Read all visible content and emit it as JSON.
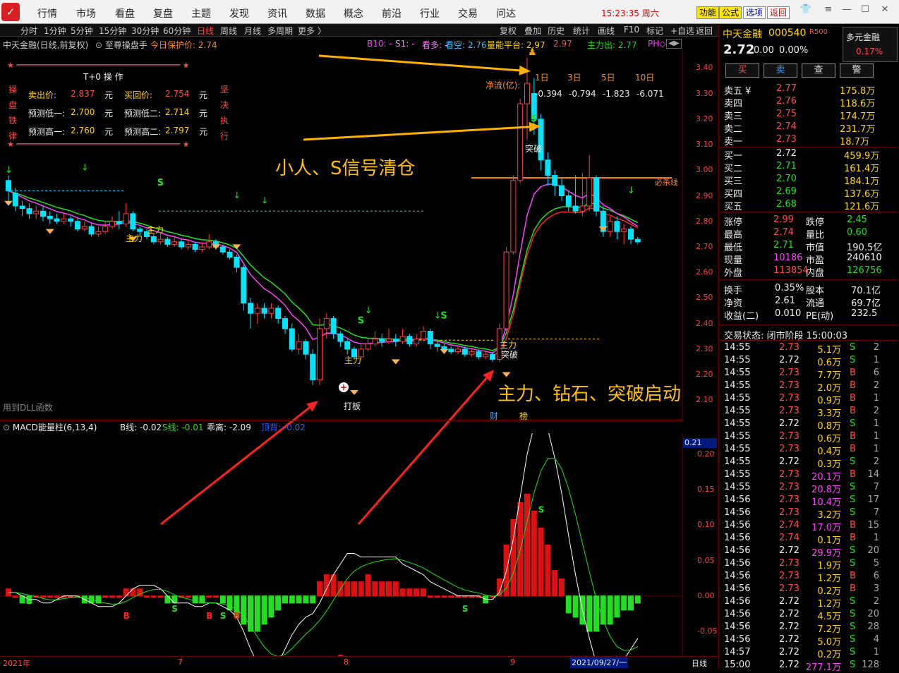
{
  "app": {
    "logo": "✓",
    "menu": [
      "行情",
      "市场",
      "看盘",
      "复盘",
      "主题",
      "发现",
      "资讯",
      "数据",
      "概念",
      "前沿",
      "行业",
      "交易",
      "问达"
    ],
    "clock": "15:23:35 周六",
    "buttons": [
      "功能",
      "公式",
      "选项",
      "返回"
    ]
  },
  "toolbar": {
    "periods": [
      "分时",
      "1分钟",
      "5分钟",
      "15分钟",
      "30分钟",
      "60分钟",
      "日线",
      "周线",
      "月线",
      "多周期",
      "更多 〉"
    ],
    "right_tools": [
      "复权",
      "叠加",
      "历史",
      "统计",
      "画线",
      "F10",
      "标记",
      "+自选",
      "返回"
    ]
  },
  "chart_header": {
    "title": "中天金融(日线,前复权)",
    "formula": "至尊操盘手",
    "protect": "今日保护价: 2.74",
    "b10": "B10: -",
    "s1": "S1: -",
    "kanduo": "看多: -",
    "kankong": "看空: 2.76",
    "platform": "量能平台: 2.97",
    "platform2": "2.97",
    "zhuli": "主力出: 2.77",
    "ph": "PH◇"
  },
  "t0": {
    "title": "T+0 操 作",
    "side_left": [
      "操",
      "盘",
      "铁",
      "律"
    ],
    "side_right": [
      "坚",
      "决",
      "执",
      "行"
    ],
    "sell_label": "卖出价:",
    "sell": "2.837",
    "buyback_label": "买回价:",
    "buyback": "2.754",
    "low1_label": "预测低一:",
    "low1": "2.700",
    "low2_label": "预测低二:",
    "low2": "2.714",
    "high1_label": "预测高一:",
    "high1": "2.760",
    "high2_label": "预测高二:",
    "high2": "2.797",
    "unit": "元"
  },
  "netflow": {
    "label": "净流(亿):",
    "headers": [
      "1日",
      "3日",
      "5日",
      "10日"
    ],
    "values": [
      "-0.394",
      "-0.794",
      "-1.823",
      "-6.071"
    ]
  },
  "annotations": {
    "a1": "小人、S信号清仓",
    "a2": "主力、钻石、突破启动",
    "kill_line": "必杀线",
    "zhuli": "主力",
    "tupo": "突破",
    "daban": "打板",
    "dll": "用到DLL函数",
    "cai": "财",
    "bang": "榜"
  },
  "price_axis": [
    "3.40",
    "3.30",
    "3.20",
    "3.10",
    "3.00",
    "2.90",
    "2.80",
    "2.70",
    "2.60",
    "2.50",
    "2.40",
    "2.30",
    "2.20",
    "2.10"
  ],
  "macd": {
    "title": "MACD能量柱(6,13,4)",
    "b": "B线: -0.02",
    "s": "S线: -0.01",
    "div": "乖离: -2.09",
    "extra": "顶背: -0.02",
    "current": "0.21",
    "axis": [
      "0.20",
      "0.15",
      "0.10",
      "0.05",
      "0.00",
      "-0.05"
    ]
  },
  "xaxis": {
    "labels": [
      "2021年",
      "7",
      "8",
      "9"
    ],
    "date": "2021/09/27/一",
    "mode": "日线"
  },
  "stock": {
    "name": "中天金融",
    "code": "000540",
    "tag": "R500",
    "sector": "多元金融",
    "price": "2.72",
    "change": "0.00",
    "pct": "0.00%",
    "sector_pct": "0.17%",
    "actions": [
      "买",
      "卖",
      "查",
      "警"
    ]
  },
  "orderbook": {
    "asks": [
      [
        "卖五 ¥",
        "2.77",
        "175.8万"
      ],
      [
        "卖四",
        "2.76",
        "118.6万"
      ],
      [
        "卖三",
        "2.75",
        "174.7万"
      ],
      [
        "卖二",
        "2.74",
        "231.7万"
      ],
      [
        "卖一",
        "2.73",
        "18.7万"
      ]
    ],
    "bids": [
      [
        "买一",
        "2.72",
        "459.9万"
      ],
      [
        "买二",
        "2.71",
        "161.4万"
      ],
      [
        "买三",
        "2.70",
        "184.1万"
      ],
      [
        "买四",
        "2.69",
        "137.6万"
      ],
      [
        "买五",
        "2.68",
        "121.6万"
      ]
    ]
  },
  "stats": [
    [
      "涨停",
      "2.99",
      "跌停",
      "2.45"
    ],
    [
      "最高",
      "2.74",
      "量比",
      "0.60"
    ],
    [
      "最低",
      "2.71",
      "市值",
      "190.5亿"
    ],
    [
      "现量",
      "10186",
      "市盈",
      "240610"
    ],
    [
      "外盘",
      "113854",
      "内盘",
      "126756"
    ]
  ],
  "stats2": [
    [
      "换手",
      "0.35%",
      "股本",
      "70.1亿"
    ],
    [
      "净资",
      "2.61",
      "流通",
      "69.7亿"
    ],
    [
      "收益(二)",
      "0.010",
      "PE(动)",
      "232.5"
    ]
  ],
  "trade_status": "交易状态: 闭市阶段 15:00:03",
  "ticks": [
    [
      "14:55",
      "2.73",
      "5.1万",
      "S",
      "2"
    ],
    [
      "14:55",
      "2.72",
      "0.6万",
      "S",
      "1"
    ],
    [
      "14:55",
      "2.73",
      "7.7万",
      "B",
      "6"
    ],
    [
      "14:55",
      "2.73",
      "2.0万",
      "B",
      "2"
    ],
    [
      "14:55",
      "2.73",
      "0.9万",
      "B",
      "1"
    ],
    [
      "14:55",
      "2.73",
      "3.3万",
      "B",
      "2"
    ],
    [
      "14:55",
      "2.72",
      "0.8万",
      "S",
      "1"
    ],
    [
      "14:55",
      "2.73",
      "0.6万",
      "B",
      "1"
    ],
    [
      "14:55",
      "2.73",
      "0.4万",
      "B",
      "1"
    ],
    [
      "14:55",
      "2.72",
      "0.3万",
      "S",
      "2"
    ],
    [
      "14:55",
      "2.73",
      "20.1万",
      "B",
      "14"
    ],
    [
      "14:55",
      "2.73",
      "20.8万",
      "S",
      "7"
    ],
    [
      "14:56",
      "2.73",
      "10.4万",
      "S",
      "17"
    ],
    [
      "14:56",
      "2.73",
      "3.2万",
      "S",
      "7"
    ],
    [
      "14:56",
      "2.74",
      "17.0万",
      "B",
      "15"
    ],
    [
      "14:56",
      "2.74",
      "0.1万",
      "B",
      "1"
    ],
    [
      "14:56",
      "2.72",
      "29.9万",
      "S",
      "20"
    ],
    [
      "14:56",
      "2.73",
      "1.9万",
      "S",
      "5"
    ],
    [
      "14:56",
      "2.73",
      "1.2万",
      "B",
      "6"
    ],
    [
      "14:56",
      "2.73",
      "0.2万",
      "B",
      "3"
    ],
    [
      "14:56",
      "2.72",
      "1.2万",
      "S",
      "2"
    ],
    [
      "14:56",
      "2.72",
      "4.5万",
      "S",
      "20"
    ],
    [
      "14:56",
      "2.72",
      "7.2万",
      "S",
      "28"
    ],
    [
      "14:56",
      "2.72",
      "5.0万",
      "S",
      "4"
    ],
    [
      "14:57",
      "2.72",
      "0.2万",
      "S",
      "1"
    ],
    [
      "15:00",
      "2.72",
      "277.1万",
      "S",
      "128"
    ]
  ],
  "colors": {
    "up": "#ff4040",
    "down": "#00e5ff",
    "ma_fast": "#ff40ff",
    "ma_slow": "#20e020",
    "annotation": "#ffc000"
  },
  "candles": [
    [
      2.96,
      2.92,
      2.98,
      2.88
    ],
    [
      2.91,
      2.86,
      2.93,
      2.84
    ],
    [
      2.86,
      2.85,
      2.88,
      2.82
    ],
    [
      2.85,
      2.83,
      2.87,
      2.81
    ],
    [
      2.83,
      2.84,
      2.86,
      2.81
    ],
    [
      2.84,
      2.82,
      2.86,
      2.8
    ],
    [
      2.82,
      2.81,
      2.84,
      2.79
    ],
    [
      2.81,
      2.8,
      2.83,
      2.79
    ],
    [
      2.8,
      2.81,
      2.83,
      2.79
    ],
    [
      2.81,
      2.8,
      2.82,
      2.78
    ],
    [
      2.8,
      2.77,
      2.81,
      2.76
    ],
    [
      2.77,
      2.78,
      2.8,
      2.76
    ],
    [
      2.78,
      2.75,
      2.79,
      2.74
    ],
    [
      2.75,
      2.76,
      2.78,
      2.74
    ],
    [
      2.76,
      2.78,
      2.8,
      2.75
    ],
    [
      2.78,
      2.8,
      2.82,
      2.77
    ],
    [
      2.8,
      2.79,
      2.84,
      2.77
    ],
    [
      2.79,
      2.83,
      2.87,
      2.78
    ],
    [
      2.83,
      2.77,
      2.84,
      2.76
    ],
    [
      2.77,
      2.76,
      2.78,
      2.74
    ],
    [
      2.76,
      2.74,
      2.77,
      2.73
    ],
    [
      2.74,
      2.72,
      2.75,
      2.71
    ],
    [
      2.72,
      2.73,
      2.75,
      2.71
    ],
    [
      2.73,
      2.71,
      2.74,
      2.7
    ],
    [
      2.71,
      2.72,
      2.74,
      2.7
    ],
    [
      2.72,
      2.7,
      2.73,
      2.69
    ],
    [
      2.7,
      2.71,
      2.73,
      2.69
    ],
    [
      2.71,
      2.69,
      2.72,
      2.68
    ],
    [
      2.69,
      2.7,
      2.72,
      2.68
    ],
    [
      2.7,
      2.72,
      2.75,
      2.69
    ],
    [
      2.72,
      2.7,
      2.73,
      2.69
    ],
    [
      2.7,
      2.68,
      2.71,
      2.67
    ],
    [
      2.68,
      2.66,
      2.69,
      2.65
    ],
    [
      2.66,
      2.62,
      2.67,
      2.6
    ],
    [
      2.62,
      2.48,
      2.63,
      2.45
    ],
    [
      2.48,
      2.44,
      2.5,
      2.38
    ],
    [
      2.44,
      2.46,
      2.48,
      2.4
    ],
    [
      2.46,
      2.44,
      2.48,
      2.42
    ],
    [
      2.44,
      2.46,
      2.48,
      2.42
    ],
    [
      2.46,
      2.42,
      2.47,
      2.4
    ],
    [
      2.42,
      2.38,
      2.43,
      2.36
    ],
    [
      2.38,
      2.3,
      2.4,
      2.29
    ],
    [
      2.3,
      2.33,
      2.36,
      2.28
    ],
    [
      2.33,
      2.28,
      2.34,
      2.26
    ],
    [
      2.28,
      2.18,
      2.3,
      2.16
    ],
    [
      2.18,
      2.38,
      2.42,
      2.16
    ],
    [
      2.38,
      2.42,
      2.44,
      2.34
    ],
    [
      2.42,
      2.36,
      2.43,
      2.34
    ],
    [
      2.36,
      2.33,
      2.37,
      2.31
    ],
    [
      2.33,
      2.3,
      2.34,
      2.28
    ],
    [
      2.3,
      2.27,
      2.31,
      2.26
    ],
    [
      2.27,
      2.3,
      2.32,
      2.26
    ],
    [
      2.3,
      2.32,
      2.34,
      2.29
    ],
    [
      2.32,
      2.34,
      2.37,
      2.31
    ],
    [
      2.34,
      2.33,
      2.36,
      2.31
    ],
    [
      2.33,
      2.34,
      2.38,
      2.32
    ],
    [
      2.34,
      2.33,
      2.36,
      2.31
    ],
    [
      2.33,
      2.35,
      2.38,
      2.32
    ],
    [
      2.35,
      2.32,
      2.36,
      2.31
    ],
    [
      2.32,
      2.34,
      2.36,
      2.31
    ],
    [
      2.34,
      2.37,
      2.39,
      2.33
    ],
    [
      2.37,
      2.32,
      2.38,
      2.3
    ],
    [
      2.32,
      2.31,
      2.33,
      2.29
    ],
    [
      2.31,
      2.3,
      2.32,
      2.29
    ],
    [
      2.3,
      2.29,
      2.31,
      2.28
    ],
    [
      2.29,
      2.3,
      2.31,
      2.28
    ],
    [
      2.3,
      2.28,
      2.31,
      2.27
    ],
    [
      2.28,
      2.29,
      2.3,
      2.27
    ],
    [
      2.29,
      2.27,
      2.3,
      2.26
    ],
    [
      2.27,
      2.28,
      2.29,
      2.26
    ],
    [
      2.28,
      2.26,
      2.29,
      2.25
    ],
    [
      2.26,
      2.38,
      2.4,
      2.25
    ],
    [
      2.38,
      2.68,
      2.7,
      2.37
    ],
    [
      2.68,
      2.96,
      2.98,
      2.67
    ],
    [
      2.96,
      3.26,
      3.28,
      2.95
    ],
    [
      3.26,
      3.34,
      3.44,
      3.12
    ],
    [
      3.3,
      3.2,
      3.36,
      3.14
    ],
    [
      3.2,
      3.04,
      3.22,
      3.0
    ],
    [
      3.04,
      2.98,
      3.07,
      2.94
    ],
    [
      2.98,
      2.94,
      3.0,
      2.9
    ],
    [
      2.94,
      2.9,
      2.97,
      2.88
    ],
    [
      2.9,
      2.86,
      2.92,
      2.84
    ],
    [
      2.86,
      2.84,
      2.98,
      2.83
    ],
    [
      2.84,
      2.86,
      2.99,
      2.82
    ],
    [
      2.86,
      2.97,
      3.06,
      2.84
    ],
    [
      2.97,
      2.84,
      2.98,
      2.82
    ],
    [
      2.84,
      2.76,
      2.86,
      2.74
    ],
    [
      2.76,
      2.8,
      2.82,
      2.74
    ],
    [
      2.8,
      2.76,
      2.82,
      2.73
    ],
    [
      2.76,
      2.77,
      2.79,
      2.71
    ],
    [
      2.77,
      2.73,
      2.78,
      2.71
    ],
    [
      2.73,
      2.72,
      2.74,
      2.71
    ]
  ],
  "macd_bars": [
    0.01,
    0.0,
    -0.01,
    -0.01,
    0.0,
    0.0,
    0.0,
    0.0,
    0.0,
    0.0,
    0.0,
    -0.01,
    -0.01,
    -0.01,
    0.0,
    0.0,
    0.0,
    0.01,
    0.01,
    0.01,
    0.0,
    0.0,
    0.0,
    -0.01,
    -0.01,
    0.0,
    0.0,
    -0.01,
    -0.01,
    0.0,
    0.0,
    -0.01,
    -0.02,
    -0.03,
    -0.04,
    -0.05,
    -0.05,
    -0.04,
    -0.03,
    -0.02,
    -0.01,
    -0.01,
    -0.01,
    -0.01,
    -0.01,
    0.02,
    0.03,
    0.03,
    0.02,
    0.02,
    0.02,
    0.02,
    0.03,
    0.02,
    0.02,
    0.02,
    0.02,
    0.01,
    0.01,
    0.01,
    0.01,
    0.0,
    0.0,
    0.0,
    0.0,
    0.0,
    0.0,
    0.0,
    0.0,
    -0.01,
    0.0,
    0.02,
    0.06,
    0.09,
    0.11,
    0.12,
    0.1,
    0.08,
    0.06,
    0.03,
    0.02,
    -0.02,
    -0.03,
    -0.04,
    -0.05,
    -0.05,
    -0.04,
    -0.04,
    -0.03,
    -0.02,
    -0.02,
    -0.01
  ]
}
